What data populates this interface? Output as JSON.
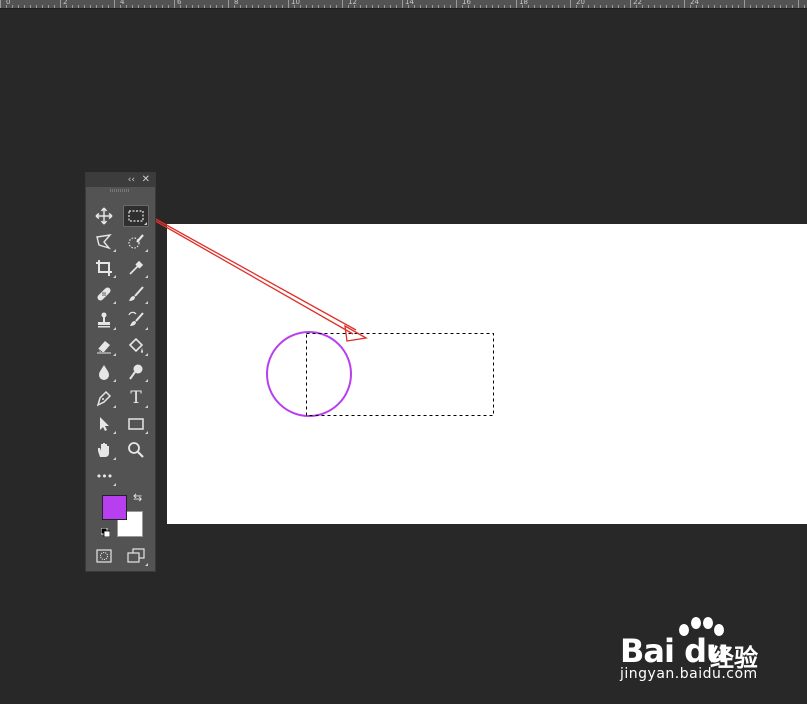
{
  "window": {
    "ruler_numbers": [
      "0",
      "2",
      "4",
      "6",
      "8",
      "10",
      "12",
      "14",
      "16",
      "18",
      "20",
      "22",
      "24"
    ]
  },
  "toolbox": {
    "collapse_glyph": "‹‹",
    "close_glyph": "✕",
    "type_tool_glyph": "T",
    "more_tools_glyph": "•••",
    "swap_colors_glyph": "⇆",
    "active_tool": "rectangular-marquee-tool",
    "foreground_color": "#b83ff0",
    "background_color": "#ffffff",
    "tools": [
      "move-tool",
      "rectangular-marquee-tool",
      "lasso-tool",
      "quick-selection-tool",
      "crop-tool",
      "eyedropper-tool",
      "healing-brush-tool",
      "brush-tool",
      "clone-stamp-tool",
      "history-brush-tool",
      "eraser-tool",
      "paint-bucket-tool",
      "blur-tool",
      "dodge-tool",
      "pen-tool",
      "type-tool",
      "path-selection-tool",
      "rectangle-tool",
      "hand-tool",
      "zoom-tool",
      "edit-toolbar",
      "quick-mask-mode",
      "screen-mode"
    ]
  },
  "canvas": {
    "background": "#ffffff",
    "circle_stroke": "#b83ff0",
    "selection_style": "marching-ants",
    "annotation_arrow_color": "#e0302a"
  },
  "watermark": {
    "brand": "Bai du",
    "brand_cn": "经验",
    "url": "jingyan.baidu.com"
  }
}
